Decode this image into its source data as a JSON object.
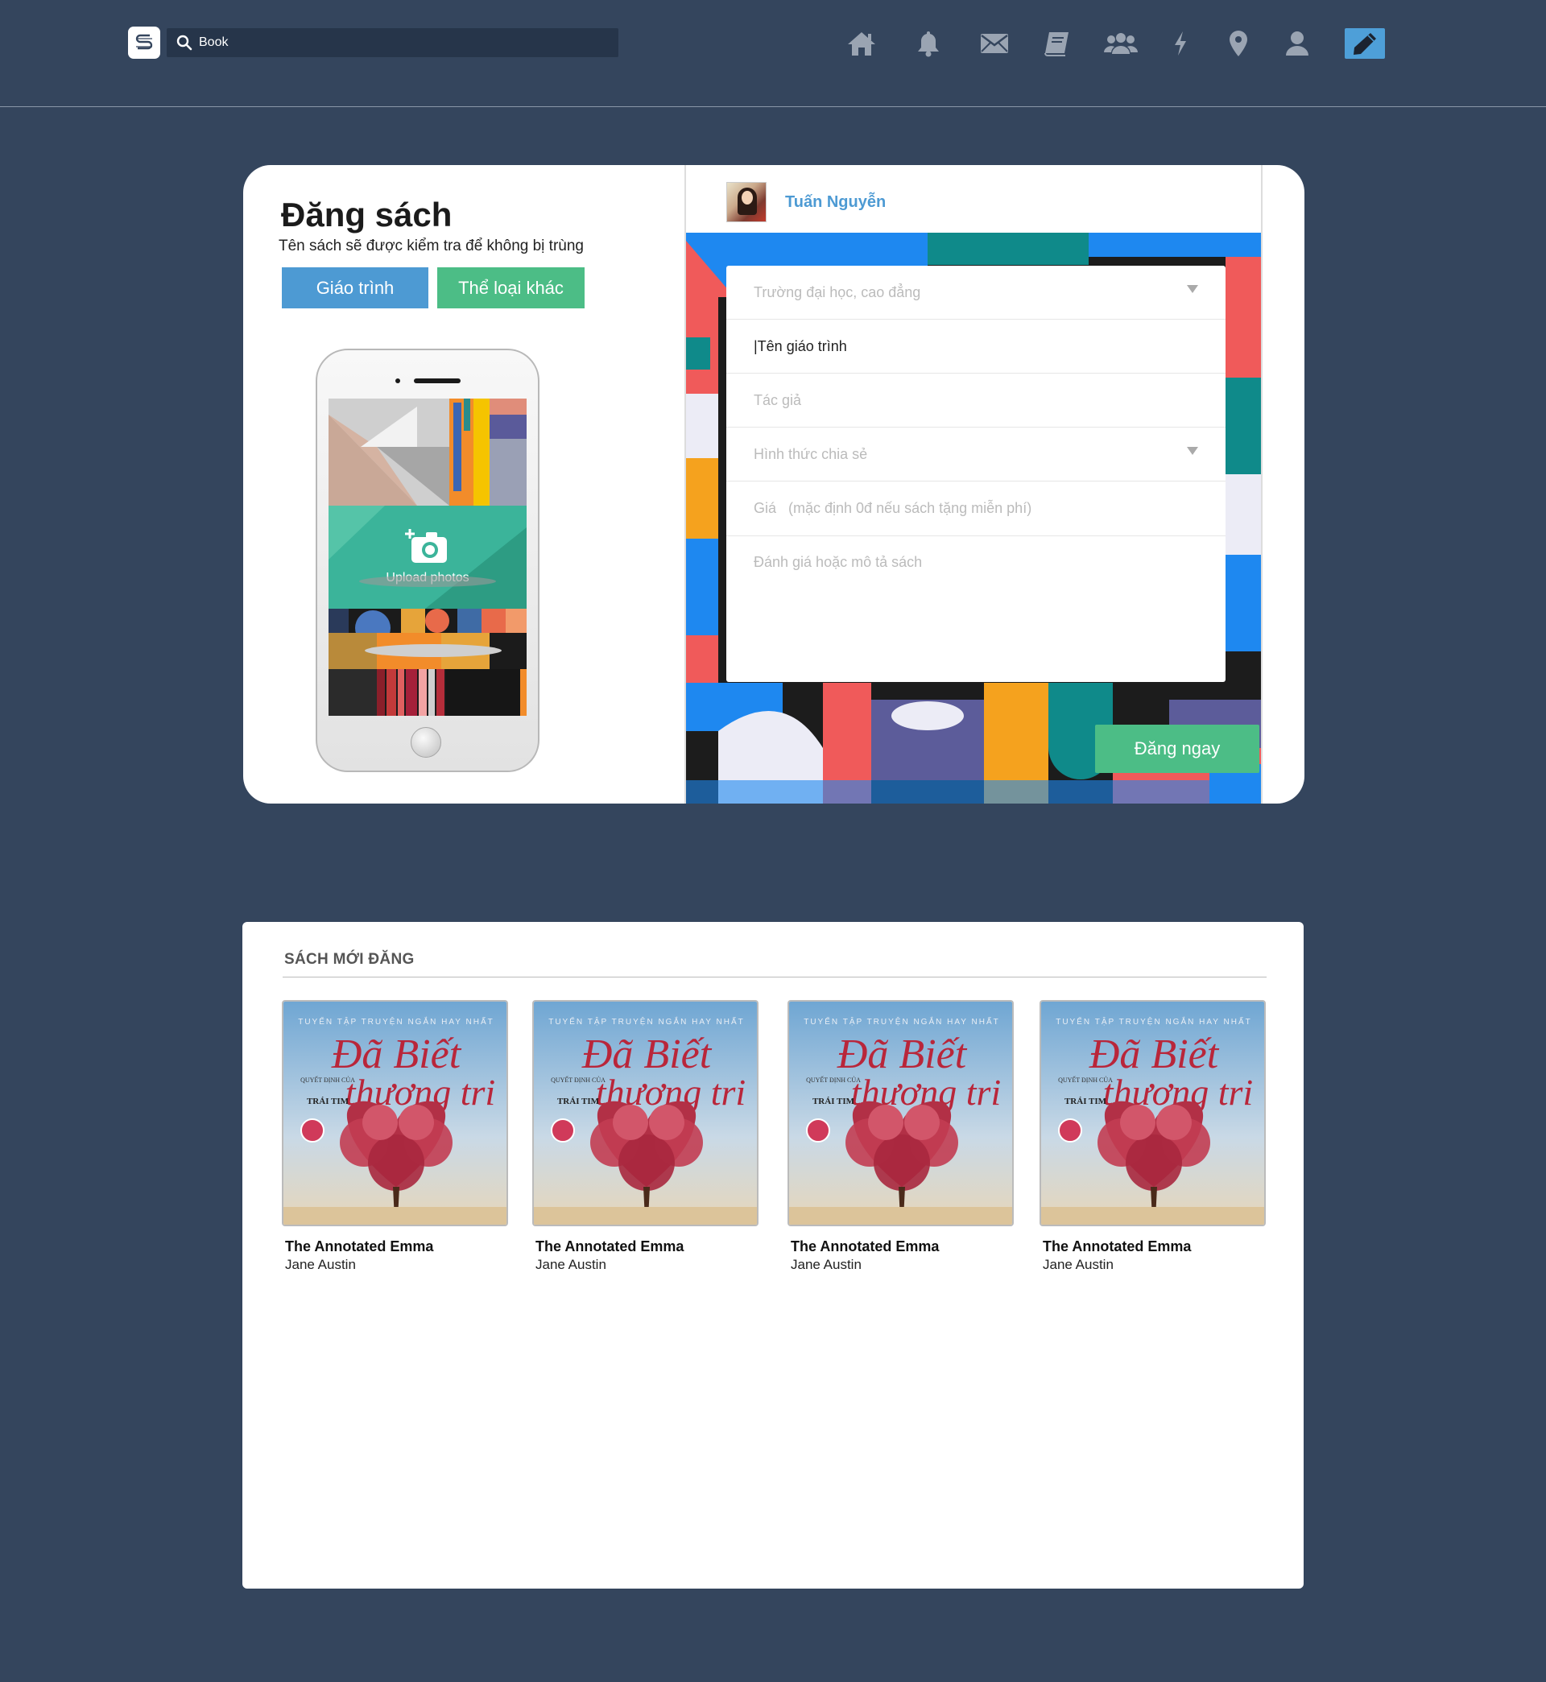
{
  "topbar": {
    "logo_icon": "s-logo-icon",
    "search": {
      "value": "Book",
      "icon": "search-icon"
    },
    "nav_icons": [
      "home-icon",
      "bell-icon",
      "mail-icon",
      "book-icon",
      "group-icon",
      "lightning-icon",
      "location-pin-icon",
      "user-icon",
      "pencil-icon"
    ]
  },
  "upload": {
    "title": "Đăng sách",
    "subtitle": "Tên sách sẽ được kiểm tra để không bị trùng",
    "buttons": {
      "textbook": "Giáo trình",
      "other": "Thể loại khác"
    },
    "upload_label": "Upload photos",
    "user_name": "Tuấn Nguyễn",
    "form": {
      "school_placeholder": "Trường đại học, cao đẳng",
      "name_value": "|Tên giáo trình",
      "author_placeholder": "Tác giả",
      "share_placeholder": "Hình thức chia sẻ",
      "price_placeholder": "Giá   (mặc định 0đ nếu sách tặng miễn phí)",
      "desc_placeholder": "Đánh giá hoặc mô tả sách"
    },
    "submit": "Đăng ngay"
  },
  "recent": {
    "title": "SÁCH MỚI ĐĂNG",
    "cover_text": {
      "top": "TUYỂN TẬP TRUYỆN NGẮN HAY NHẤT",
      "script": "Đã Biết",
      "script2": "thương tri",
      "side": "QUYẾT ĐỊNH CỦA",
      "side2": "TRÁI TIM"
    },
    "books": [
      {
        "title": "The Annotated Emma",
        "author": "Jane Austin"
      },
      {
        "title": "The Annotated Emma",
        "author": "Jane Austin"
      },
      {
        "title": "The Annotated Emma",
        "author": "Jane Austin"
      },
      {
        "title": "The Annotated Emma",
        "author": "Jane Austin"
      }
    ]
  },
  "colors": {
    "background": "#34455d",
    "blue": "#4d9ad3",
    "green": "#4cbd86"
  }
}
